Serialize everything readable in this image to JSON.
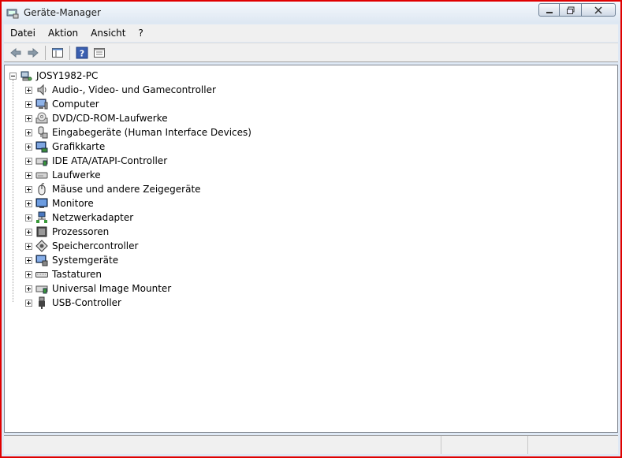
{
  "window": {
    "title": "Geräte-Manager",
    "title_icon": "device-manager-icon",
    "border_color": "#e00000"
  },
  "menu": {
    "items": [
      "Datei",
      "Aktion",
      "Ansicht",
      "?"
    ]
  },
  "toolbar": {
    "buttons": [
      "back-icon",
      "forward-icon",
      "show-hide-console-tree-icon",
      "help-icon",
      "properties-icon"
    ]
  },
  "tree": {
    "root": {
      "label": "JOSY1982-PC",
      "icon": "computer-network-icon",
      "expanded": true
    },
    "items": [
      {
        "label": "Audio-, Video- und Gamecontroller",
        "icon": "speaker-icon"
      },
      {
        "label": "Computer",
        "icon": "computer-icon"
      },
      {
        "label": "DVD/CD-ROM-Laufwerke",
        "icon": "dvd-drive-icon"
      },
      {
        "label": "Eingabegeräte (Human Interface Devices)",
        "icon": "hid-icon"
      },
      {
        "label": "Grafikkarte",
        "icon": "display-adapter-icon"
      },
      {
        "label": "IDE ATA/ATAPI-Controller",
        "icon": "ide-controller-icon"
      },
      {
        "label": "Laufwerke",
        "icon": "disk-drive-icon"
      },
      {
        "label": "Mäuse und andere Zeigegeräte",
        "icon": "mouse-icon"
      },
      {
        "label": "Monitore",
        "icon": "monitor-icon"
      },
      {
        "label": "Netzwerkadapter",
        "icon": "network-adapter-icon"
      },
      {
        "label": "Prozessoren",
        "icon": "processor-icon"
      },
      {
        "label": "Speichercontroller",
        "icon": "storage-controller-icon"
      },
      {
        "label": "Systemgeräte",
        "icon": "system-devices-icon"
      },
      {
        "label": "Tastaturen",
        "icon": "keyboard-icon"
      },
      {
        "label": "Universal Image Mounter",
        "icon": "image-mounter-icon"
      },
      {
        "label": "USB-Controller",
        "icon": "usb-icon"
      }
    ]
  },
  "status": {
    "segments": [
      "",
      "",
      ""
    ]
  }
}
